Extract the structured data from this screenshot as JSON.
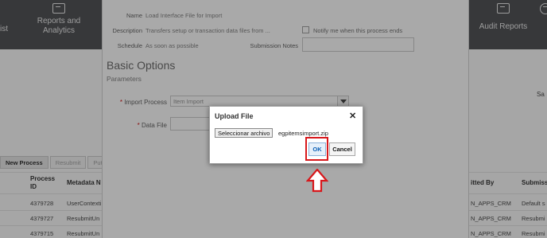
{
  "topnav": {
    "items": [
      {
        "label": "ist"
      },
      {
        "label": "Reports and Analytics",
        "line1": "Reports and",
        "line2": "Analytics"
      },
      {
        "label": "Audit Reports"
      }
    ]
  },
  "background": {
    "right_partial": "Sa",
    "buttons": {
      "new_process": "New Process",
      "resubmit": "Resubmit",
      "put": "Put"
    },
    "columns": {
      "process_id_1": "Process",
      "process_id_2": "ID",
      "metadata": "Metadata N",
      "submitted_by": "itted By",
      "submission": "Submiss"
    },
    "rows": [
      {
        "id": "4379728",
        "metadata": "UserContexti",
        "by": "N_APPS_CRM",
        "sub": "Default s"
      },
      {
        "id": "4379727",
        "metadata": "ResubmitUn",
        "by": "N_APPS_CRM",
        "sub": "Resubmi"
      },
      {
        "id": "4379715",
        "metadata": "ResubmitUn",
        "by": "N_APPS_CRM",
        "sub": "Resubmi"
      }
    ]
  },
  "process_dialog": {
    "name_label": "Name",
    "name_value": "Load Interface File for Import",
    "description_label": "Description",
    "description_value": "Transfers setup or transaction data files from ...",
    "notify_label": "Notify me when this process ends",
    "schedule_label": "Schedule",
    "schedule_value": "As soon as possible",
    "submission_notes_label": "Submission Notes",
    "basic_options": "Basic Options",
    "parameters": "Parameters",
    "import_process_label": "Import Process",
    "import_process_value": "Item Import",
    "data_file_label": "Data File",
    "required_mark": "*"
  },
  "upload_dialog": {
    "title": "Upload File",
    "close": "✕",
    "choose_file": "Seleccionar archivo",
    "file_name": "egpitemsimport.zip",
    "ok": "OK",
    "cancel": "Cancel"
  },
  "annotation": {
    "color": "#d8171b"
  }
}
